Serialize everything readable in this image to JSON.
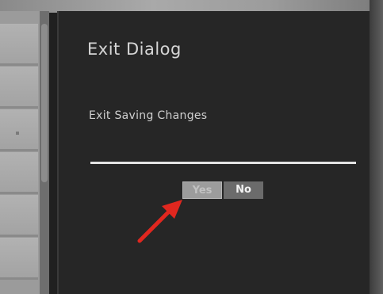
{
  "dialog": {
    "title": "Exit Dialog",
    "message": "Exit Saving Changes",
    "yes_label": "Yes",
    "no_label": "No"
  },
  "annotation": {
    "arrow_color": "#e0271f",
    "points_to": "yes-button"
  },
  "colors": {
    "dialog_bg": "#262626",
    "text": "#d6d6d6",
    "yes_button_bg": "#9c9c9c",
    "no_button_bg": "#6b6b6b"
  }
}
